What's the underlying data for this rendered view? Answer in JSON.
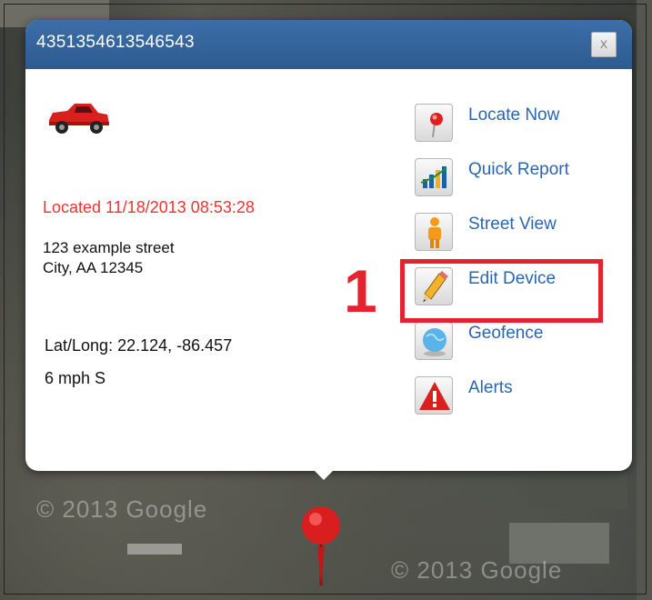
{
  "popup": {
    "title": "4351354613546543",
    "close_label": "x",
    "located": "Located 11/18/2013 08:53:28",
    "address_line1": "123 example street",
    "address_line2": "City, AA 12345",
    "latlong_label": "Lat/Long:",
    "latlong_value": "22.124, -86.457",
    "speed": "6 mph S"
  },
  "actions": [
    {
      "label": "Locate Now",
      "icon": "pin-icon"
    },
    {
      "label": "Quick Report",
      "icon": "report-chart-icon"
    },
    {
      "label": "Street View",
      "icon": "pegman-icon"
    },
    {
      "label": "Edit Device",
      "icon": "pencil-icon"
    },
    {
      "label": "Geofence",
      "icon": "globe-icon"
    },
    {
      "label": "Alerts",
      "icon": "warning-icon"
    }
  ],
  "annotation": {
    "step_number": "1",
    "highlight_color": "#e3232f"
  },
  "map": {
    "watermark_left": "© 2013 Google",
    "watermark_right": "© 2013 Google"
  },
  "colors": {
    "header": "#2d5b90",
    "link": "#2a66b0",
    "located": "#ee3333"
  }
}
